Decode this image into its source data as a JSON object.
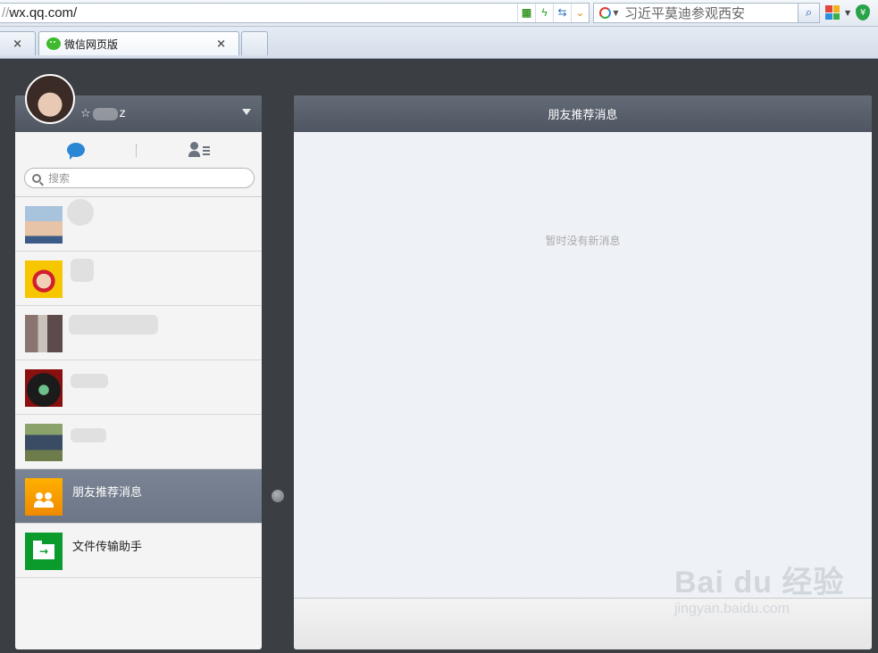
{
  "browser": {
    "url_prefix": "//",
    "url_host": "wx.qq.com/",
    "search_text": "习近平莫迪参观西安",
    "tabs": [
      {
        "label": "",
        "active": false
      },
      {
        "label": "微信网页版",
        "active": true
      }
    ]
  },
  "profile": {
    "name_prefix": "☆",
    "name_suffix": "z"
  },
  "sidebar": {
    "search_placeholder": "搜索",
    "chats": [
      {
        "name": "",
        "avatar": "child-photo"
      },
      {
        "name": "",
        "avatar": "cartoon-girl"
      },
      {
        "name": "",
        "avatar": "group-collage"
      },
      {
        "name": "",
        "avatar": "dark-anime"
      },
      {
        "name": "",
        "avatar": "man-photo"
      },
      {
        "name": "朋友推荐消息",
        "avatar": "friends-icon",
        "active": true
      },
      {
        "name": "文件传输助手",
        "avatar": "file-transfer-icon"
      }
    ]
  },
  "main": {
    "title": "朋友推荐消息",
    "empty_text": "暂时没有新消息"
  },
  "watermark": {
    "brand": "Bai du 经验",
    "domain": "jingyan.baidu.com"
  },
  "colors": {
    "header": "#58606b",
    "active_item": "#737d8d",
    "wechat_green": "#3fba2e",
    "file_green": "#0a9b2c"
  }
}
